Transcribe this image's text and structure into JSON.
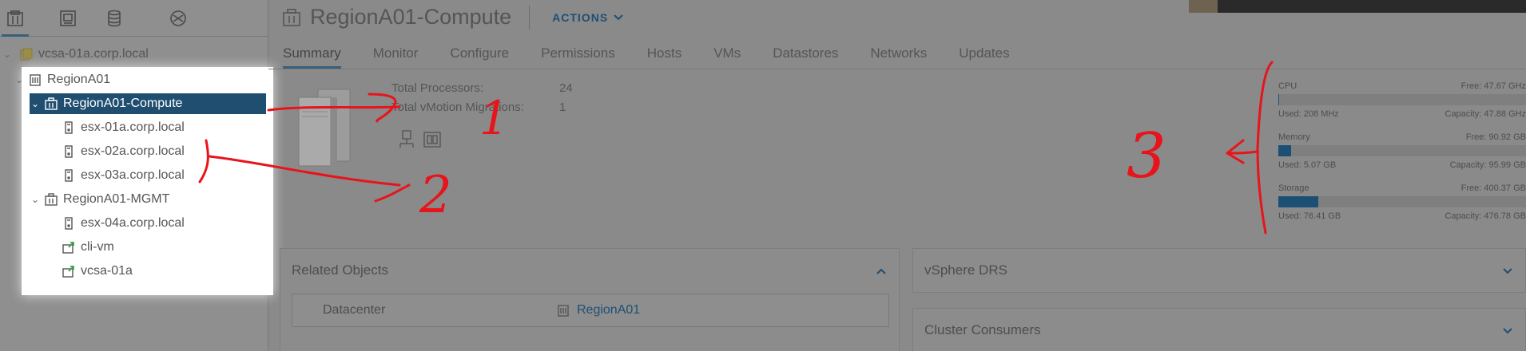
{
  "nav": {
    "tabs": [
      {
        "icon": "hosts-clusters-icon",
        "active": true
      },
      {
        "icon": "vms-templates-icon",
        "active": false
      },
      {
        "icon": "storage-icon",
        "active": false
      },
      {
        "icon": "networking-icon",
        "active": false
      }
    ],
    "root": "vcsa-01a.corp.local",
    "tree": [
      {
        "label": "RegionA01",
        "icon": "datacenter-icon",
        "expanded": true
      },
      {
        "label": "RegionA01-Compute",
        "icon": "cluster-icon",
        "expanded": true,
        "selected": true
      },
      {
        "label": "esx-01a.corp.local",
        "icon": "host-icon"
      },
      {
        "label": "esx-02a.corp.local",
        "icon": "host-icon"
      },
      {
        "label": "esx-03a.corp.local",
        "icon": "host-icon"
      },
      {
        "label": "RegionA01-MGMT",
        "icon": "cluster-icon",
        "expanded": true
      },
      {
        "label": "esx-04a.corp.local",
        "icon": "host-icon"
      },
      {
        "label": "cli-vm",
        "icon": "vm-icon"
      },
      {
        "label": "vcsa-01a",
        "icon": "vm-icon"
      }
    ]
  },
  "header": {
    "title": "RegionA01-Compute",
    "actions_label": "ACTIONS"
  },
  "tabs": [
    "Summary",
    "Monitor",
    "Configure",
    "Permissions",
    "Hosts",
    "VMs",
    "Datastores",
    "Networks",
    "Updates"
  ],
  "summary": {
    "total_processors_label": "Total Processors:",
    "total_processors_value": "24",
    "vmotion_label": "Total vMotion Migrations:",
    "vmotion_value": "1"
  },
  "resources": {
    "cpu": {
      "name": "CPU",
      "free": "Free: 47.67 GHz",
      "used": "Used: 208 MHz",
      "capacity": "Capacity: 47.88 GHz",
      "fraction": 0.004
    },
    "memory": {
      "name": "Memory",
      "free": "Free: 90.92 GB",
      "used": "Used: 5.07 GB",
      "capacity": "Capacity: 95.99 GB",
      "fraction": 0.053
    },
    "storage": {
      "name": "Storage",
      "free": "Free: 400.37 GB",
      "used": "Used: 76.41 GB",
      "capacity": "Capacity: 476.78 GB",
      "fraction": 0.16
    }
  },
  "cards": {
    "related_objects": {
      "title": "Related Objects",
      "datacenter_label": "Datacenter",
      "datacenter_value": "RegionA01"
    },
    "drs": {
      "title": "vSphere DRS"
    },
    "consumers": {
      "title": "Cluster Consumers"
    }
  },
  "annotations": {
    "one": "1",
    "two": "2",
    "three": "3"
  },
  "colors": {
    "accent": "#1d4f74",
    "annotation": "#e8141b",
    "selected_bg": "#1f4e70"
  }
}
